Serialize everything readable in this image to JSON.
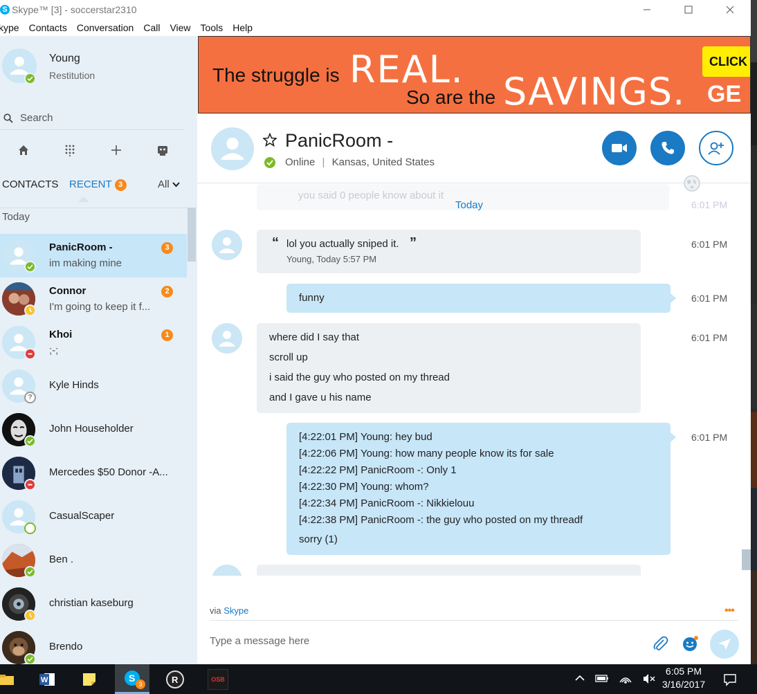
{
  "window": {
    "title": "Skype™ [3] - soccerstar2310"
  },
  "menu": [
    "kype",
    "Contacts",
    "Conversation",
    "Call",
    "View",
    "Tools",
    "Help"
  ],
  "profile": {
    "name": "Young",
    "mood": "Restitution"
  },
  "search": {
    "placeholder": "Search"
  },
  "tabs": {
    "contacts": "CONTACTS",
    "recent": "RECENT",
    "recent_count": "3",
    "filter": "All"
  },
  "section": {
    "today": "Today"
  },
  "recent": [
    {
      "name": "PanicRoom -",
      "message": "im making mine",
      "badge": "3",
      "status": "online"
    },
    {
      "name": "Connor",
      "message": "I'm going to keep it f...",
      "badge": "2",
      "status": "away"
    },
    {
      "name": "Khoi",
      "message": ";-;",
      "badge": "1",
      "status": "busy"
    },
    {
      "name": "Kyle Hinds",
      "status": "unknown"
    },
    {
      "name": "John Householder",
      "status": "online"
    },
    {
      "name": "Mercedes $50 Donor -A...",
      "status": "busy"
    },
    {
      "name": "CasualScaper",
      "status": "offline"
    },
    {
      "name": "Ben .",
      "status": "online"
    },
    {
      "name": "christian kaseburg",
      "status": "away"
    },
    {
      "name": "Brendo",
      "status": "online"
    }
  ],
  "ad": {
    "line1_prefix": "The struggle is",
    "line1_big": "REAL.",
    "line2_prefix": "So are the",
    "line2_big": "SAVINGS.",
    "cta": "CLICK T",
    "cta2": "GE"
  },
  "chat": {
    "name": "PanicRoom -",
    "presence": "Online",
    "location": "Kansas, United States",
    "separator": "|"
  },
  "messages": {
    "faded_text": "you said 0 people know about it",
    "faded_link": "Today",
    "faded_time": "6:01 PM",
    "quote_text": "lol you actually sniped it.",
    "quote_source": "Young, Today 5:57 PM",
    "quote_time": "6:01 PM",
    "funny_text": "funny",
    "funny_time": "6:01 PM",
    "in_lines": [
      "where did I say that",
      "scroll up",
      "i said the guy who posted on my thread",
      "and I gave u his name"
    ],
    "in_time": "6:01 PM",
    "log_lines": [
      "[4:22:01 PM] Young: hey bud",
      "[4:22:06 PM] Young: how many people know its for sale",
      "[4:22:22 PM] PanicRoom -: Only 1",
      "[4:22:30 PM] Young: whom?",
      "[4:22:34 PM] PanicRoom -: Nikkielouu",
      "[4:22:38 PM] PanicRoom -: the guy who posted on my threadf"
    ],
    "log_extra": "sorry (1)",
    "log_time": "6:01 PM"
  },
  "composer": {
    "via_prefix": "via",
    "via_link": "Skype",
    "placeholder": "Type a message here",
    "more": "•••"
  },
  "taskbar": {
    "time": "6:05 PM",
    "date": "3/16/2017",
    "skype_badge": "3",
    "osb": "OSB"
  },
  "colors": {
    "accent": "#1a7ac4",
    "sidebar_bg": "#e7f0f7",
    "selected": "#c7e6f8",
    "badge": "#f78a1a",
    "online": "#7cba29",
    "ad_bg": "#f57040"
  }
}
